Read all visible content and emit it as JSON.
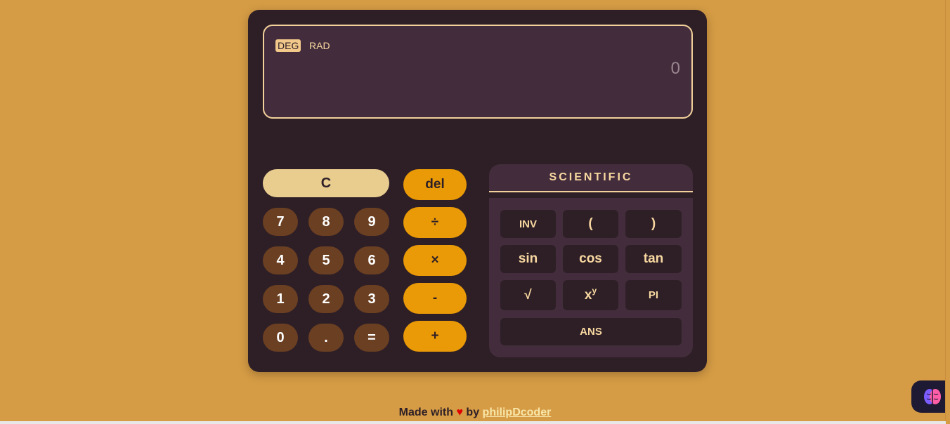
{
  "display": {
    "mode_deg": "DEG",
    "mode_rad": "RAD",
    "value": "0"
  },
  "keys": {
    "clear": "C",
    "del": "del",
    "divide": "÷",
    "multiply": "×",
    "subtract": "-",
    "add": "+",
    "n7": "7",
    "n8": "8",
    "n9": "9",
    "n4": "4",
    "n5": "5",
    "n6": "6",
    "n1": "1",
    "n2": "2",
    "n3": "3",
    "n0": "0",
    "dot": ".",
    "equals": "="
  },
  "scientific": {
    "title": "SCIENTIFIC",
    "inv": "INV",
    "lparen": "(",
    "rparen": ")",
    "sin": "sin",
    "cos": "cos",
    "tan": "tan",
    "sqrt": "√",
    "pow_base": "x",
    "pow_exp": "y",
    "pi": "PI",
    "ans": "ANS"
  },
  "footer": {
    "made_with": "Made with",
    "heart": "♥",
    "by": "by",
    "author": "philipDcoder"
  },
  "widget": {
    "icon": "brain-icon"
  },
  "colors": {
    "background": "#d69c45",
    "panel": "#2e1f27",
    "display": "#432d3c",
    "number_key": "#6b3f21",
    "operator_key": "#ea9a06",
    "clear_key": "#e8cd8f",
    "accent_text": "#f8d8a0"
  }
}
